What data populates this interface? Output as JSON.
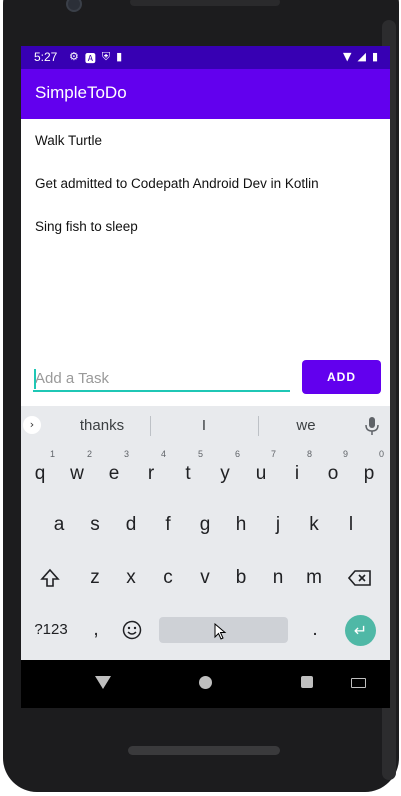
{
  "status_bar": {
    "time": "5:27",
    "icons_left": [
      "settings-icon",
      "a-icon",
      "shield-icon",
      "sd-card-icon"
    ],
    "icons_right": [
      "wifi-icon",
      "signal-icon",
      "battery-icon"
    ]
  },
  "app_bar": {
    "title": "SimpleToDo",
    "color": "#6200ee",
    "status_color": "#3700b3"
  },
  "tasks": [
    {
      "label": "Walk Turtle"
    },
    {
      "label": "Get admitted to Codepath Android Dev in Kotlin"
    },
    {
      "label": "Sing fish to sleep"
    }
  ],
  "input": {
    "placeholder": "Add a Task",
    "value": "",
    "underline_color": "#1fc7b5"
  },
  "add_button": {
    "label": "ADD"
  },
  "keyboard": {
    "suggestions": [
      "thanks",
      "I",
      "we"
    ],
    "row1": [
      {
        "k": "q",
        "n": "1"
      },
      {
        "k": "w",
        "n": "2"
      },
      {
        "k": "e",
        "n": "3"
      },
      {
        "k": "r",
        "n": "4"
      },
      {
        "k": "t",
        "n": "5"
      },
      {
        "k": "y",
        "n": "6"
      },
      {
        "k": "u",
        "n": "7"
      },
      {
        "k": "i",
        "n": "8"
      },
      {
        "k": "o",
        "n": "9"
      },
      {
        "k": "p",
        "n": "0"
      }
    ],
    "row2": [
      "a",
      "s",
      "d",
      "f",
      "g",
      "h",
      "j",
      "k",
      "l"
    ],
    "row3": [
      "z",
      "x",
      "c",
      "v",
      "b",
      "n",
      "m"
    ],
    "symbols_label": "?123",
    "comma": ",",
    "period": ".",
    "enter_color": "#4fb8a6"
  }
}
